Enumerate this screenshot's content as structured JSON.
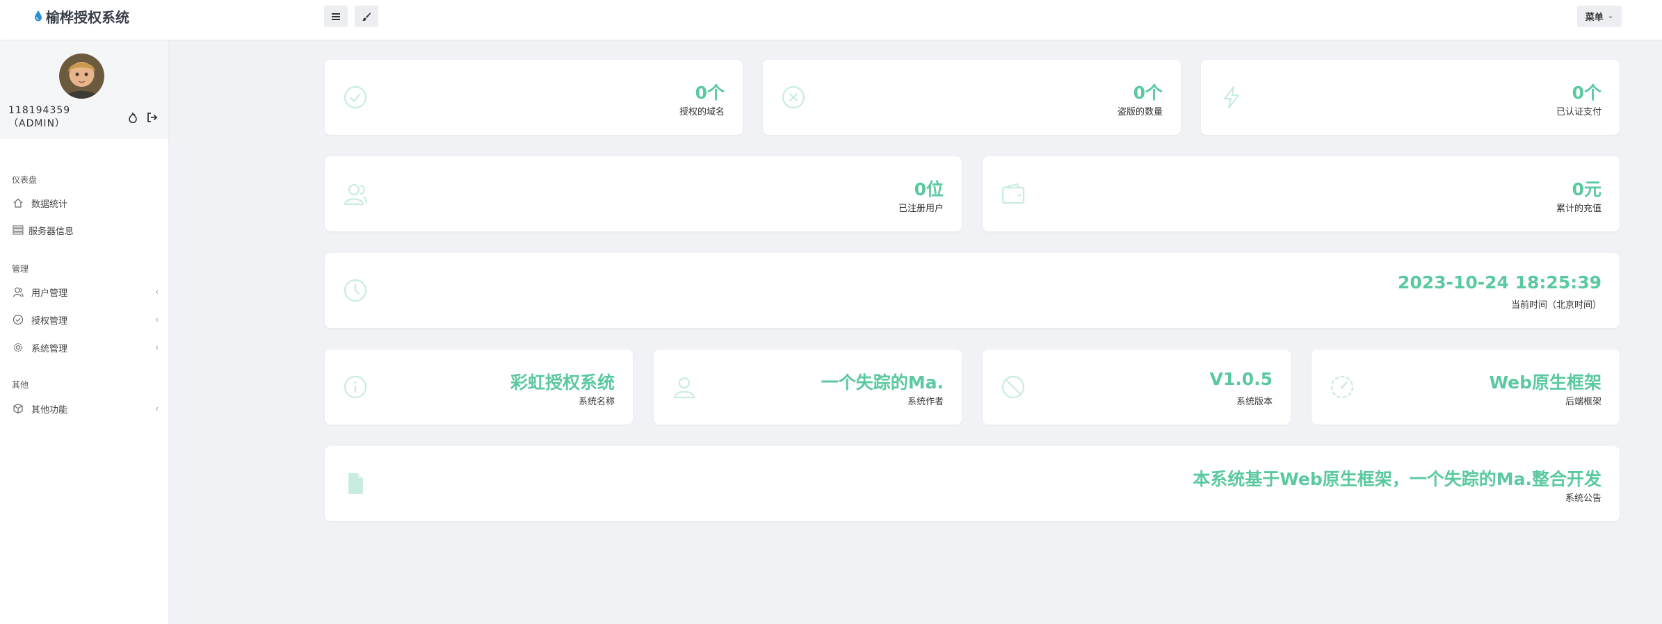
{
  "app": {
    "title": "榆桦授权系统"
  },
  "toolbar": {
    "menu_label": "菜单"
  },
  "user": {
    "name": "118194359（ADMIN）"
  },
  "sidebar": {
    "sections": [
      {
        "label": "仪表盘"
      },
      {
        "label": "管理"
      },
      {
        "label": "其他"
      }
    ],
    "items": [
      {
        "label": "数据统计",
        "icon": "home-icon"
      },
      {
        "label": "服务器信息",
        "icon": "server-icon"
      },
      {
        "label": "用户管理",
        "icon": "users-icon",
        "arrow": "‹"
      },
      {
        "label": "授权管理",
        "icon": "check-circle-icon",
        "arrow": "‹"
      },
      {
        "label": "系统管理",
        "icon": "gear-icon",
        "arrow": "‹"
      },
      {
        "label": "其他功能",
        "icon": "box-icon",
        "arrow": "‹"
      }
    ]
  },
  "stats": {
    "domains": {
      "value": "0个",
      "label": "授权的域名"
    },
    "pirated": {
      "value": "0个",
      "label": "盗版的数量"
    },
    "payments": {
      "value": "0个",
      "label": "已认证支付"
    },
    "users": {
      "value": "0位",
      "label": "已注册用户"
    },
    "recharge": {
      "value": "0元",
      "label": "累计的充值"
    },
    "time": {
      "value": "2023-10-24 18:25:39",
      "label": "当前时间（北京时间）"
    },
    "sys_name": {
      "value": "彩虹授权系统",
      "label": "系统名称"
    },
    "author": {
      "value": "一个失踪的Ma.",
      "label": "系统作者"
    },
    "version": {
      "value": "V1.0.5",
      "label": "系统版本"
    },
    "framework": {
      "value": "Web原生框架",
      "label": "后端框架"
    },
    "notice": {
      "value": "本系统基于Web原生框架，一个失踪的Ma.整合开发",
      "label": "系统公告"
    }
  },
  "colors": {
    "accent": "#5bc9a0",
    "icon": "#c8ece0",
    "brand_icon": "#2b8fd6"
  }
}
